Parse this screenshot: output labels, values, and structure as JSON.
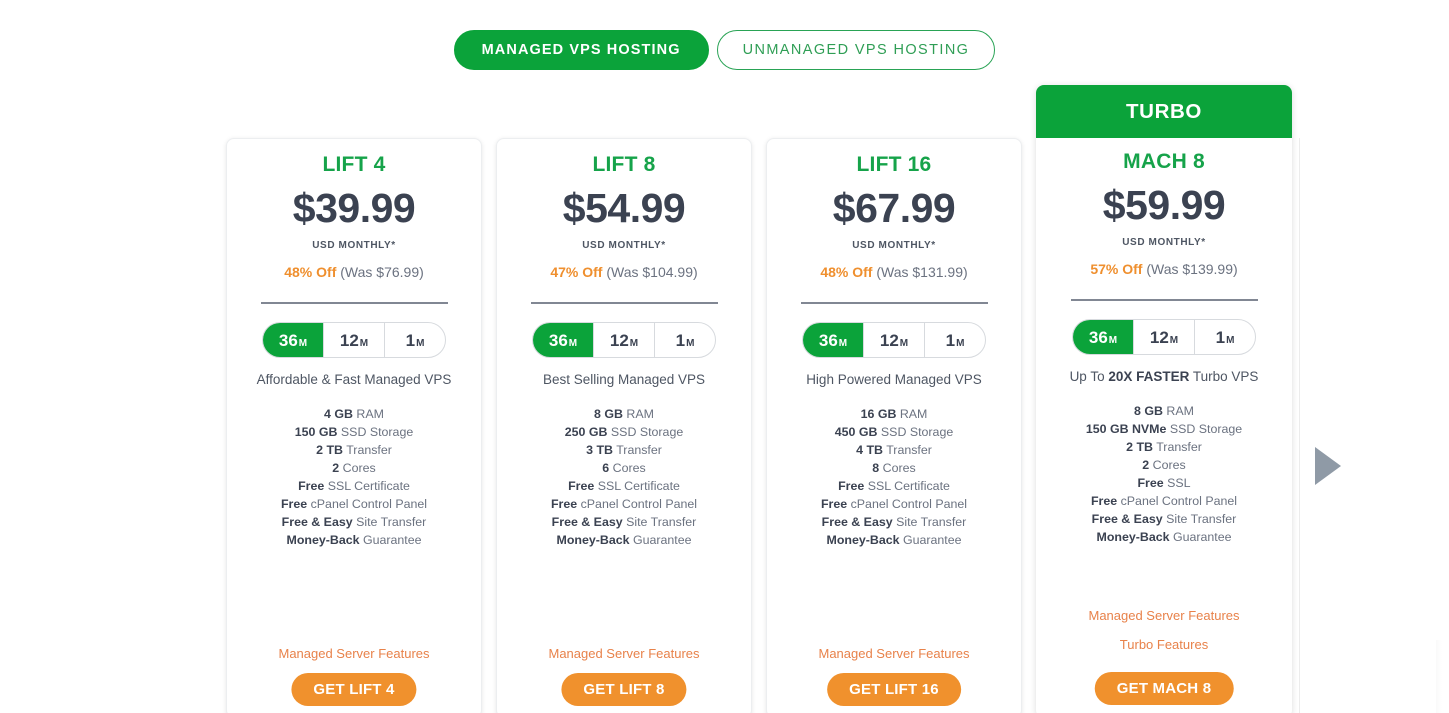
{
  "tabs": [
    {
      "label": "MANAGED VPS HOSTING",
      "active": true
    },
    {
      "label": "UNMANAGED VPS HOSTING",
      "active": false
    }
  ],
  "colors": {
    "green": "#0ba33a",
    "plan_green": "#16a34a",
    "orange": "#f0912d",
    "discount_orange": "#ef8f2e",
    "link_orange": "#e8824a",
    "price_gray": "#3b4251",
    "arrow_gray": "#8f9aa6"
  },
  "terms": [
    {
      "value": "36",
      "unit": "M",
      "active": true
    },
    {
      "value": "12",
      "unit": "M",
      "active": false
    },
    {
      "value": "1",
      "unit": "M",
      "active": false
    }
  ],
  "carousel": {
    "next_icon": "triangle-right-icon"
  },
  "plans": [
    {
      "badge": null,
      "name": "LIFT 4",
      "price": "$39.99",
      "usd": "USD MONTHLY*",
      "discount_pct": "48% Off",
      "was": "(Was $76.99)",
      "tagline_prefix": "Affordable & Fast Managed VPS",
      "tagline_bold": "",
      "tagline_suffix": "",
      "features": [
        {
          "bold": "4 GB",
          "rest": " RAM"
        },
        {
          "bold": "150 GB",
          "rest": " SSD Storage"
        },
        {
          "bold": "2 TB",
          "rest": " Transfer"
        },
        {
          "bold": "2",
          "rest": " Cores"
        },
        {
          "bold": "Free",
          "rest": " SSL Certificate"
        },
        {
          "bold": "Free",
          "rest": " cPanel Control Panel"
        },
        {
          "bold": "Free & Easy",
          "rest": " Site Transfer"
        },
        {
          "bold": "Money-Back",
          "rest": " Guarantee"
        }
      ],
      "links": [
        "Managed Server Features"
      ],
      "cta": "GET LIFT 4"
    },
    {
      "badge": null,
      "name": "LIFT 8",
      "price": "$54.99",
      "usd": "USD MONTHLY*",
      "discount_pct": "47% Off",
      "was": "(Was $104.99)",
      "tagline_prefix": "Best Selling Managed VPS",
      "tagline_bold": "",
      "tagline_suffix": "",
      "features": [
        {
          "bold": "8 GB",
          "rest": " RAM"
        },
        {
          "bold": "250 GB",
          "rest": " SSD Storage"
        },
        {
          "bold": "3 TB",
          "rest": " Transfer"
        },
        {
          "bold": "6",
          "rest": " Cores"
        },
        {
          "bold": "Free",
          "rest": " SSL Certificate"
        },
        {
          "bold": "Free",
          "rest": " cPanel Control Panel"
        },
        {
          "bold": "Free & Easy",
          "rest": " Site Transfer"
        },
        {
          "bold": "Money-Back",
          "rest": " Guarantee"
        }
      ],
      "links": [
        "Managed Server Features"
      ],
      "cta": "GET LIFT 8"
    },
    {
      "badge": null,
      "name": "LIFT 16",
      "price": "$67.99",
      "usd": "USD MONTHLY*",
      "discount_pct": "48% Off",
      "was": "(Was $131.99)",
      "tagline_prefix": "High Powered Managed VPS",
      "tagline_bold": "",
      "tagline_suffix": "",
      "features": [
        {
          "bold": "16 GB",
          "rest": " RAM"
        },
        {
          "bold": "450 GB",
          "rest": " SSD Storage"
        },
        {
          "bold": "4 TB",
          "rest": " Transfer"
        },
        {
          "bold": "8",
          "rest": " Cores"
        },
        {
          "bold": "Free",
          "rest": " SSL Certificate"
        },
        {
          "bold": "Free",
          "rest": " cPanel Control Panel"
        },
        {
          "bold": "Free & Easy",
          "rest": " Site Transfer"
        },
        {
          "bold": "Money-Back",
          "rest": " Guarantee"
        }
      ],
      "links": [
        "Managed Server Features"
      ],
      "cta": "GET LIFT 16"
    },
    {
      "badge": "TURBO",
      "name": "MACH 8",
      "price": "$59.99",
      "usd": "USD MONTHLY*",
      "discount_pct": "57% Off",
      "was": "(Was $139.99)",
      "tagline_prefix": "Up To ",
      "tagline_bold": "20X FASTER",
      "tagline_suffix": " Turbo VPS",
      "features": [
        {
          "bold": "8 GB",
          "rest": " RAM"
        },
        {
          "bold": "150 GB NVMe",
          "rest": " SSD Storage"
        },
        {
          "bold": "2 TB",
          "rest": " Transfer"
        },
        {
          "bold": "2",
          "rest": " Cores"
        },
        {
          "bold": "Free",
          "rest": " SSL"
        },
        {
          "bold": "Free",
          "rest": " cPanel Control Panel"
        },
        {
          "bold": "Free & Easy",
          "rest": " Site Transfer"
        },
        {
          "bold": "Money-Back",
          "rest": " Guarantee"
        }
      ],
      "links": [
        "Managed Server Features",
        "Turbo Features"
      ],
      "cta": "GET MACH 8"
    }
  ]
}
